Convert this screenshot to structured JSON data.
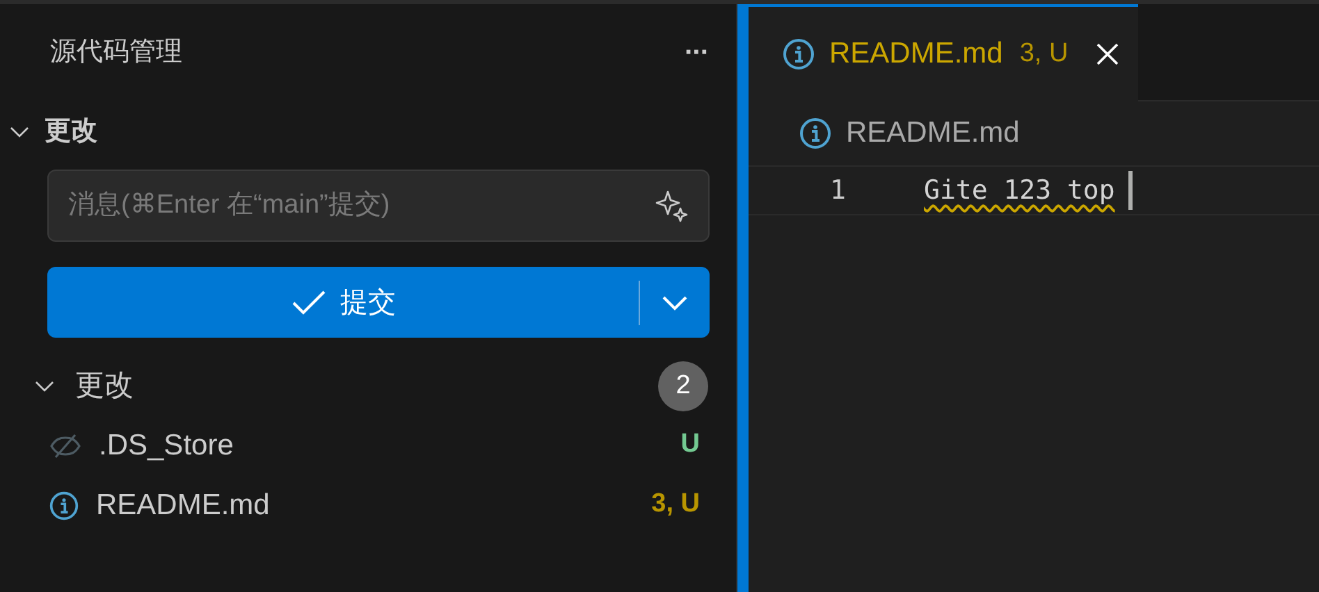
{
  "sidebar": {
    "title": "源代码管理",
    "more": "···",
    "section": {
      "label": "更改",
      "expanded": true
    },
    "commit_message": {
      "placeholder": "消息(⌘Enter 在“main”提交)"
    },
    "commit_button": {
      "label": "提交"
    },
    "changes_group": {
      "label": "更改",
      "expanded": true,
      "count": "2"
    },
    "files": [
      {
        "name": ".DS_Store",
        "kind": "ignored",
        "status": "U",
        "color": "#73c991"
      },
      {
        "name": "README.md",
        "kind": "info",
        "status": "3, U",
        "color": "#b89500"
      }
    ]
  },
  "editor": {
    "tabs": [
      {
        "label": "README.md",
        "status": "3, U",
        "selected": true
      }
    ],
    "breadcrumb": "README.md",
    "lines": [
      {
        "number": "1",
        "text": "Gite 123 top",
        "warning": true
      }
    ]
  }
}
